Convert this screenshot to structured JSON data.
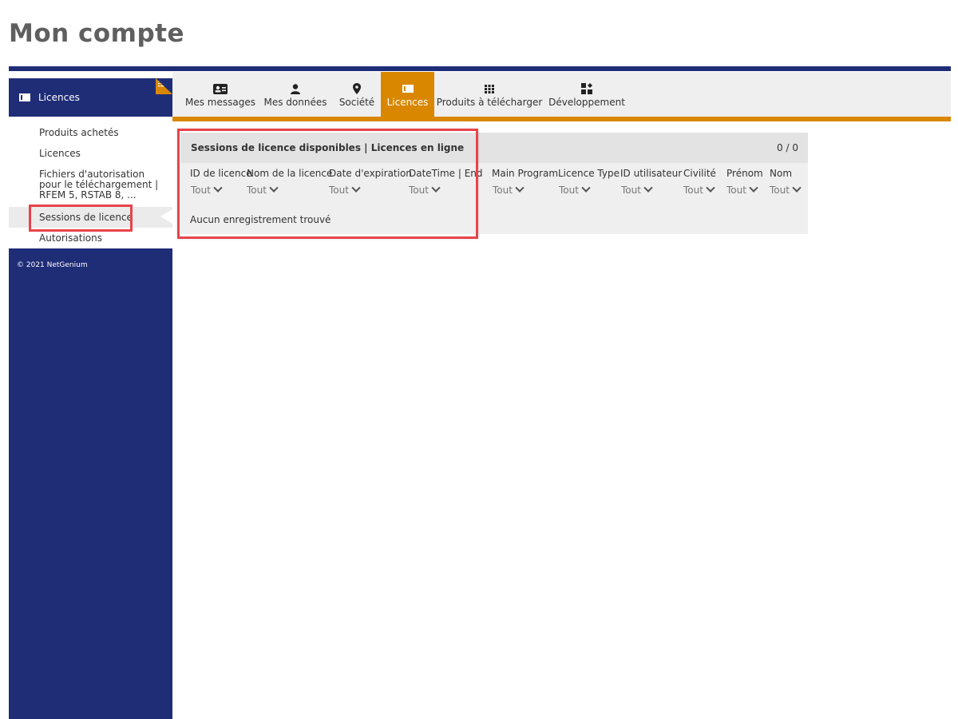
{
  "page": {
    "title": "Mon compte"
  },
  "sidebar": {
    "header_label": "Licences",
    "items": [
      {
        "label": "Produits achetés"
      },
      {
        "label": "Licences"
      },
      {
        "label": "Fichiers d'autorisation pour le téléchargement | RFEM 5, RSTAB 8, ..."
      },
      {
        "label": "Sessions de licence",
        "selected": true
      },
      {
        "label": "Autorisations"
      }
    ],
    "copyright": "© 2021 NetGenium"
  },
  "tabs": [
    {
      "label": "Mes messages",
      "icon": "id-card-icon"
    },
    {
      "label": "Mes données",
      "icon": "user-icon"
    },
    {
      "label": "Société",
      "icon": "map-pin-icon"
    },
    {
      "label": "Licences",
      "icon": "license-icon",
      "active": true
    },
    {
      "label": "Produits à télécharger",
      "icon": "grid-icon"
    },
    {
      "label": "Développement",
      "icon": "widgets-icon"
    }
  ],
  "panel": {
    "title": "Sessions de licence disponibles  |  Licences en ligne",
    "count": "0 / 0",
    "columns": [
      {
        "header": "ID de licence",
        "filter": "Tout"
      },
      {
        "header": "Nom de la licence",
        "filter": "Tout"
      },
      {
        "header": "Date d'expiration",
        "filter": "Tout"
      },
      {
        "header": "DateTime | End",
        "filter": "Tout"
      },
      {
        "header": "Main Program",
        "filter": "Tout"
      },
      {
        "header": "Licence Type",
        "filter": "Tout"
      },
      {
        "header": "ID utilisateur",
        "filter": "Tout"
      },
      {
        "header": "Civilité",
        "filter": "Tout"
      },
      {
        "header": "Prénom",
        "filter": "Tout"
      },
      {
        "header": "Nom",
        "filter": "Tout"
      }
    ],
    "empty_message": "Aucun enregistrement trouvé"
  },
  "colors": {
    "navy": "#1f2d77",
    "accent": "#d98700",
    "highlight": "#e8434a"
  }
}
